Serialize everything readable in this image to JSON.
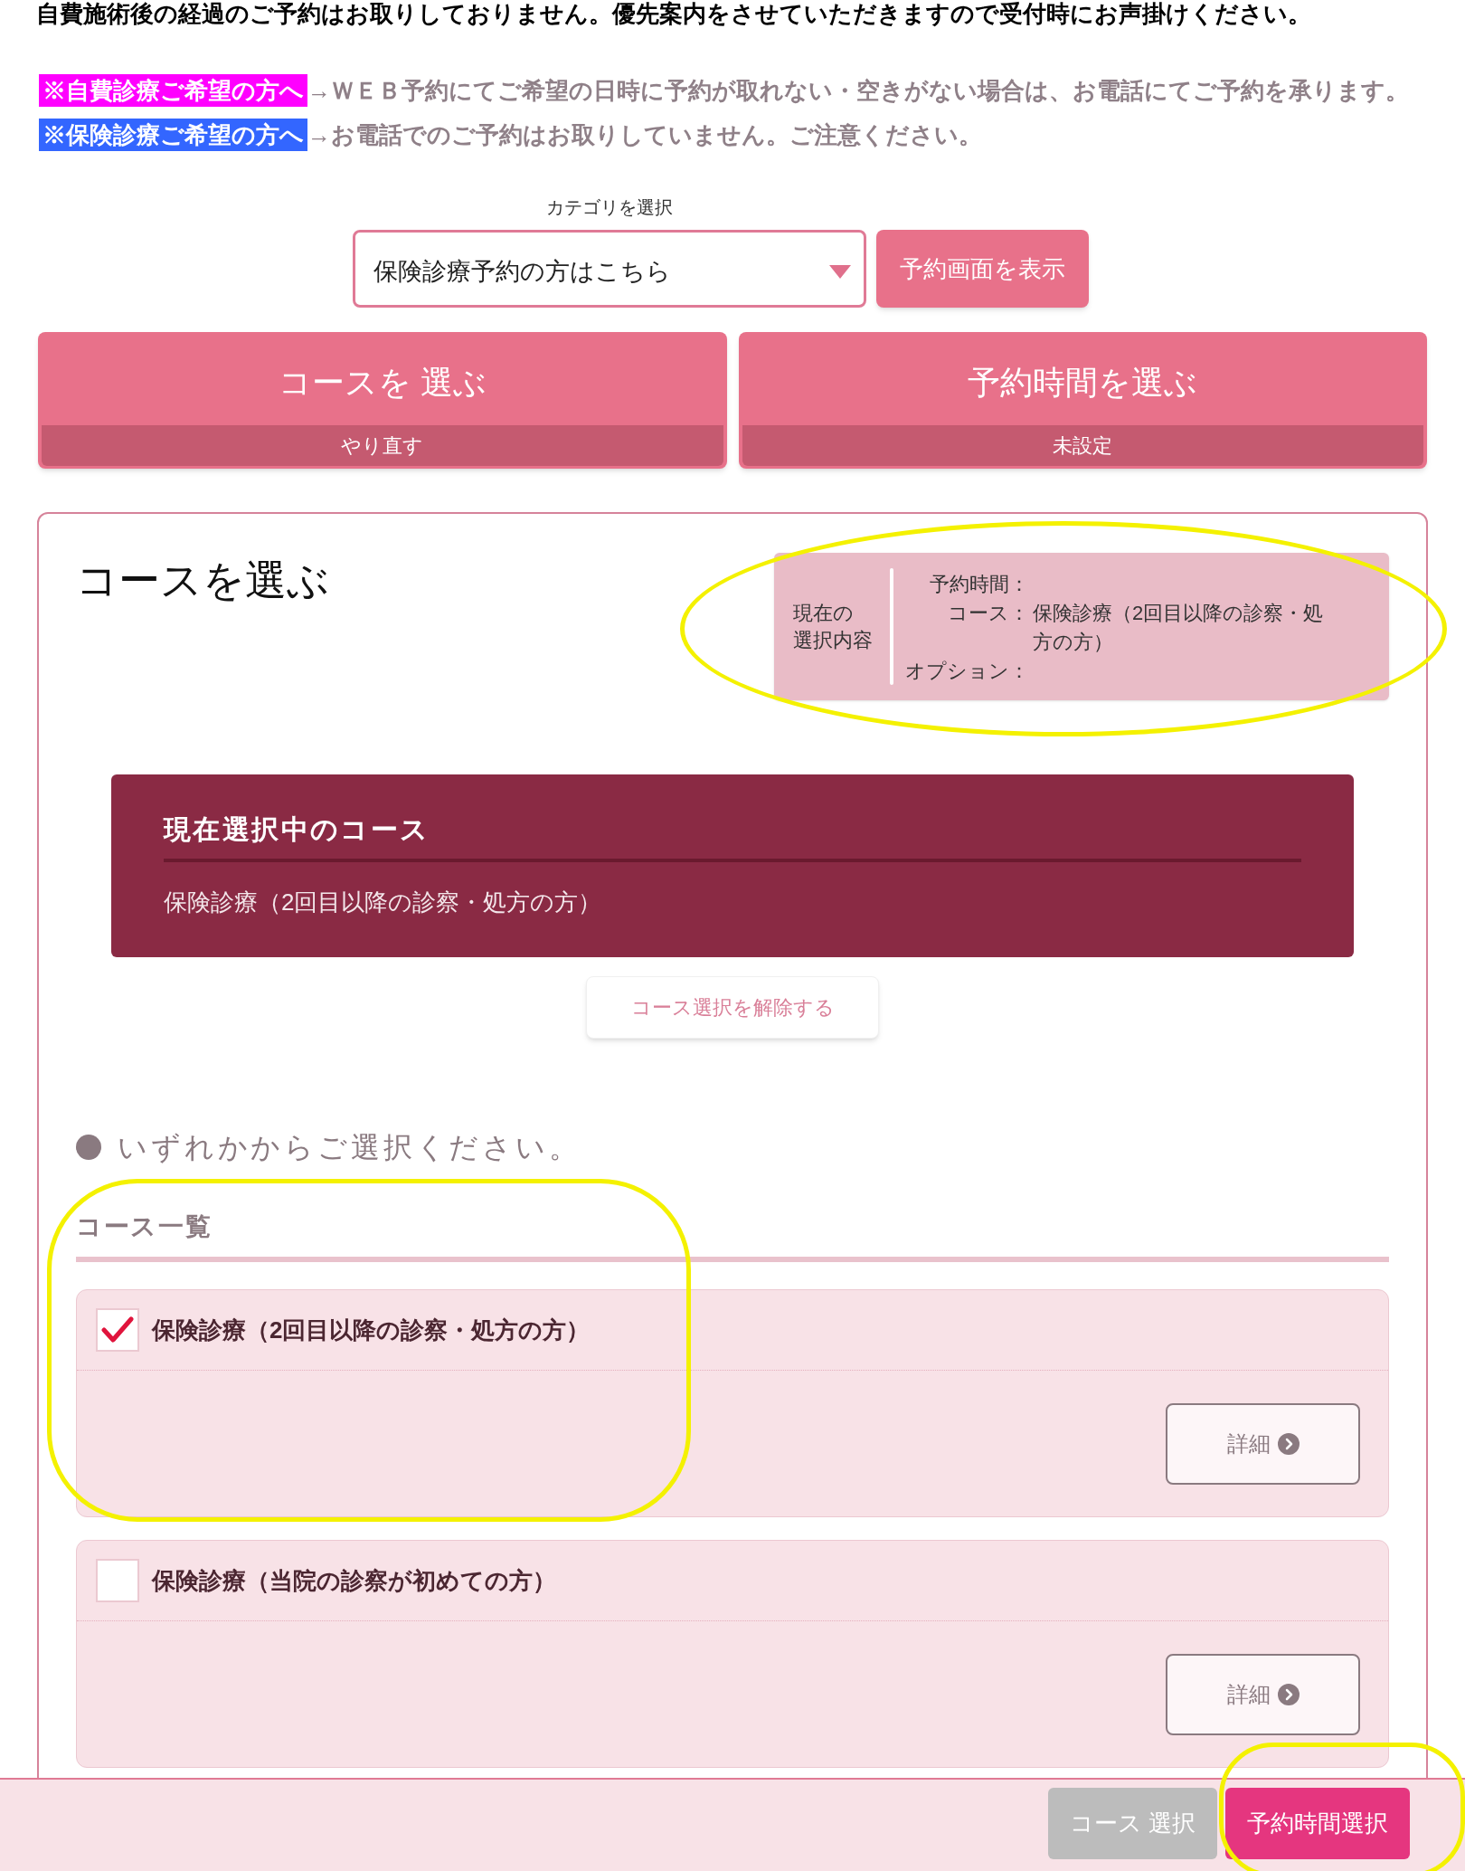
{
  "notice": {
    "text": "自費施術後の経過のご予約はお取りしておりません。優先案内をさせていただきますので受付時にお声掛けください。"
  },
  "notes": [
    {
      "label": "※自費診療ご希望の方へ",
      "color": "#ff00ff",
      "text": "→ＷＥＢ予約にてご希望の日時に予約が取れない・空きがない場合は、お電話にてご予約を承ります。"
    },
    {
      "label": "※保険診療ご希望の方へ",
      "color": "#3366ff",
      "text": "→お電話でのご予約はお取りしていません。ご注意ください。"
    }
  ],
  "category": {
    "label": "カテゴリを選択",
    "value": "保険診療予約の方はこちら",
    "button": "予約画面を表示"
  },
  "steps": [
    {
      "title": "コースを 選ぶ",
      "status": "やり直す"
    },
    {
      "title": "予約時間を選ぶ",
      "status": "未設定"
    }
  ],
  "panel": {
    "title": "コースを選ぶ"
  },
  "summary": {
    "heading_lines": [
      "現在の",
      "選択内容"
    ],
    "highlighted": true,
    "rows": [
      {
        "label": "予約時間："
      },
      {
        "label": "コース：",
        "value": "保険診療（2回目以降の診察・処方の方）"
      },
      {
        "label": "オプション："
      }
    ]
  },
  "current_course": {
    "title": "現在選択中のコース",
    "value": "保険診療（2回目以降の診察・処方の方）",
    "clear_button": "コース選択を解除する"
  },
  "instruction": "いずれかからご選択ください。",
  "course_list": {
    "title": "コース一覧",
    "highlighted": true,
    "items": [
      {
        "name": "保険診療（2回目以降の診察・処方の方）",
        "checked": true,
        "detail_button": "詳細"
      },
      {
        "name": "保険診療（当院の診察が初めての方）",
        "checked": false,
        "detail_button": "詳細"
      }
    ]
  },
  "footer": {
    "buttons": [
      {
        "label": "コース 選択",
        "disabled": true,
        "highlighted": false
      },
      {
        "label": "予約時間選択",
        "disabled": false,
        "highlighted": true
      }
    ]
  }
}
